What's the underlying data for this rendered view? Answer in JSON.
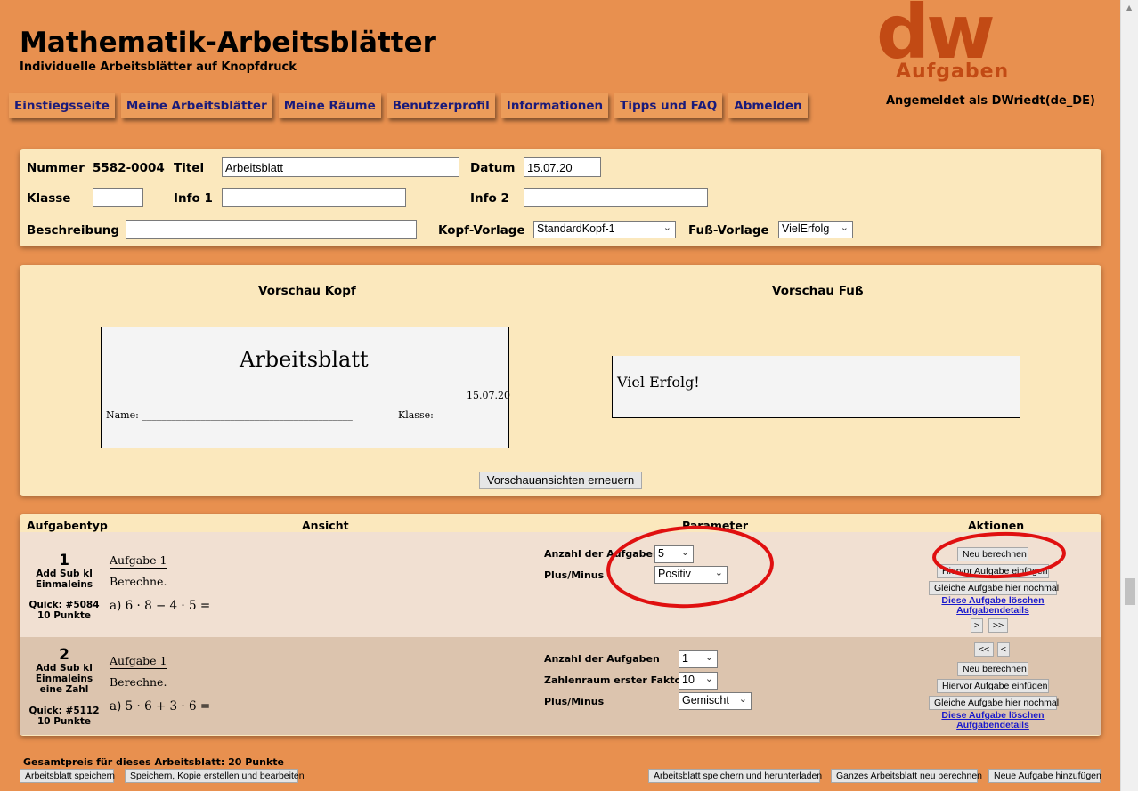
{
  "header": {
    "title": "Mathematik-Arbeitsblätter",
    "subtitle": "Individuelle Arbeitsblätter auf Knopfdruck",
    "logo_main": "dw",
    "logo_sub": "Aufgaben",
    "logged_in": "Angemeldet als DWriedt(de_DE)"
  },
  "nav": [
    "Einstiegsseite",
    "Meine Arbeitsblätter",
    "Meine Räume",
    "Benutzerprofil",
    "Informationen",
    "Tipps und FAQ",
    "Abmelden"
  ],
  "form": {
    "nummer_label": "Nummer",
    "nummer_value": "5582-0004",
    "titel_label": "Titel",
    "titel_value": "Arbeitsblatt",
    "datum_label": "Datum",
    "datum_value": "15.07.20",
    "klasse_label": "Klasse",
    "klasse_value": "",
    "info1_label": "Info 1",
    "info1_value": "",
    "info2_label": "Info 2",
    "info2_value": "",
    "beschreibung_label": "Beschreibung",
    "beschreibung_value": "",
    "kopf_label": "Kopf-Vorlage",
    "kopf_value": "StandardKopf-1",
    "fuss_label": "Fuß-Vorlage",
    "fuss_value": "VielErfolg"
  },
  "preview": {
    "kopf_title": "Vorschau Kopf",
    "fuss_title": "Vorschau Fuß",
    "kopf_heading": "Arbeitsblatt",
    "kopf_date": "15.07.20",
    "kopf_name": "Name: ___________________________________________",
    "kopf_klasse": "Klasse:",
    "fuss_text": "Viel Erfolg!",
    "refresh_button": "Vorschauansichten erneuern"
  },
  "table": {
    "col_typ": "Aufgabentyp",
    "col_ansicht": "Ansicht",
    "col_parameter": "Parameter",
    "col_aktionen": "Aktionen",
    "rows": [
      {
        "num": "1",
        "cat": "Add Sub kl Einmaleins",
        "quick": "Quick: #5084",
        "punkte": "10 Punkte",
        "aufg_title": "Aufgabe 1",
        "aufg_text": "Berechne.",
        "math": "a) 6 · 8 − 4 · 5 =",
        "params": [
          {
            "label": "Anzahl der Aufgaben",
            "value": "5"
          },
          {
            "label": "Plus/Minus",
            "value": "Positiv"
          }
        ],
        "actions": {
          "neu": "Neu berechnen",
          "hiervor": "Hiervor Aufgabe einfügen",
          "gleiche": "Gleiche Aufgabe hier nochmal",
          "loeschen": "Diese Aufgabe löschen",
          "details": "Aufgabendetails",
          "next": ">",
          "last": ">>"
        }
      },
      {
        "num": "2",
        "cat": "Add Sub kl Einmaleins eine Zahl",
        "quick": "Quick: #5112",
        "punkte": "10 Punkte",
        "aufg_title": "Aufgabe 1",
        "aufg_text": "Berechne.",
        "math": "a) 5 · 6 + 3 · 6 =",
        "params": [
          {
            "label": "Anzahl der Aufgaben",
            "value": "1"
          },
          {
            "label": "Zahlenraum erster Faktor",
            "value": "10"
          },
          {
            "label": "Plus/Minus",
            "value": "Gemischt"
          }
        ],
        "actions": {
          "first": "<<",
          "prev": "<",
          "neu": "Neu berechnen",
          "hiervor": "Hiervor Aufgabe einfügen",
          "gleiche": "Gleiche Aufgabe hier nochmal",
          "loeschen": "Diese Aufgabe löschen",
          "details": "Aufgabendetails"
        }
      }
    ]
  },
  "footer": {
    "gesamtpreis": "Gesamtpreis für dieses Arbeitsblatt: 20 Punkte",
    "save": "Arbeitsblatt speichern",
    "save_copy": "Speichern, Kopie erstellen und bearbeiten",
    "save_download": "Arbeitsblatt speichern und herunterladen",
    "recalc_all": "Ganzes Arbeitsblatt neu berechnen",
    "add_new": "Neue Aufgabe hinzufügen"
  },
  "colors": {
    "background": "#e8904f",
    "panel": "#fbe8bd",
    "nav_text": "#1a1a7a",
    "logo": "#c24a14",
    "annotation": "#e01010"
  }
}
